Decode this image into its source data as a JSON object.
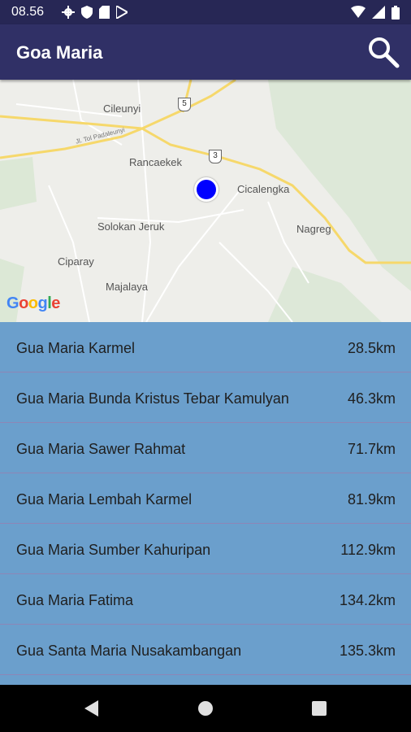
{
  "status_bar": {
    "time": "08.56"
  },
  "app_bar": {
    "title": "Goa Maria"
  },
  "map": {
    "places": [
      {
        "key": "cileunyi",
        "label": "Cileunyi"
      },
      {
        "key": "rancaekek",
        "label": "Rancaekek"
      },
      {
        "key": "cicalengka",
        "label": "Cicalengka"
      },
      {
        "key": "solokan",
        "label": "Solokan Jeruk"
      },
      {
        "key": "nagreg",
        "label": "Nagreg"
      },
      {
        "key": "ciparay",
        "label": "Ciparay"
      },
      {
        "key": "majalaya",
        "label": "Majalaya"
      }
    ],
    "road_shields": [
      "5",
      "3"
    ],
    "road_name": "Jl. Tol Padaleunyi",
    "google_logo": "Google"
  },
  "locations": [
    {
      "name": "Gua Maria Karmel",
      "distance": "28.5km"
    },
    {
      "name": "Gua Maria Bunda Kristus Tebar Kamulyan",
      "distance": "46.3km"
    },
    {
      "name": "Gua Maria Sawer Rahmat",
      "distance": "71.7km"
    },
    {
      "name": "Gua Maria Lembah Karmel",
      "distance": "81.9km"
    },
    {
      "name": "Gua Maria Sumber Kahuripan",
      "distance": "112.9km"
    },
    {
      "name": "Gua Maria Fatima",
      "distance": "134.2km"
    },
    {
      "name": "Gua Santa Maria Nusakambangan",
      "distance": "135.3km"
    }
  ],
  "colors": {
    "app_bar": "#303066",
    "list_bg": "#6b9fcc",
    "divider": "#8d86b6",
    "marker": "#0000ff"
  }
}
